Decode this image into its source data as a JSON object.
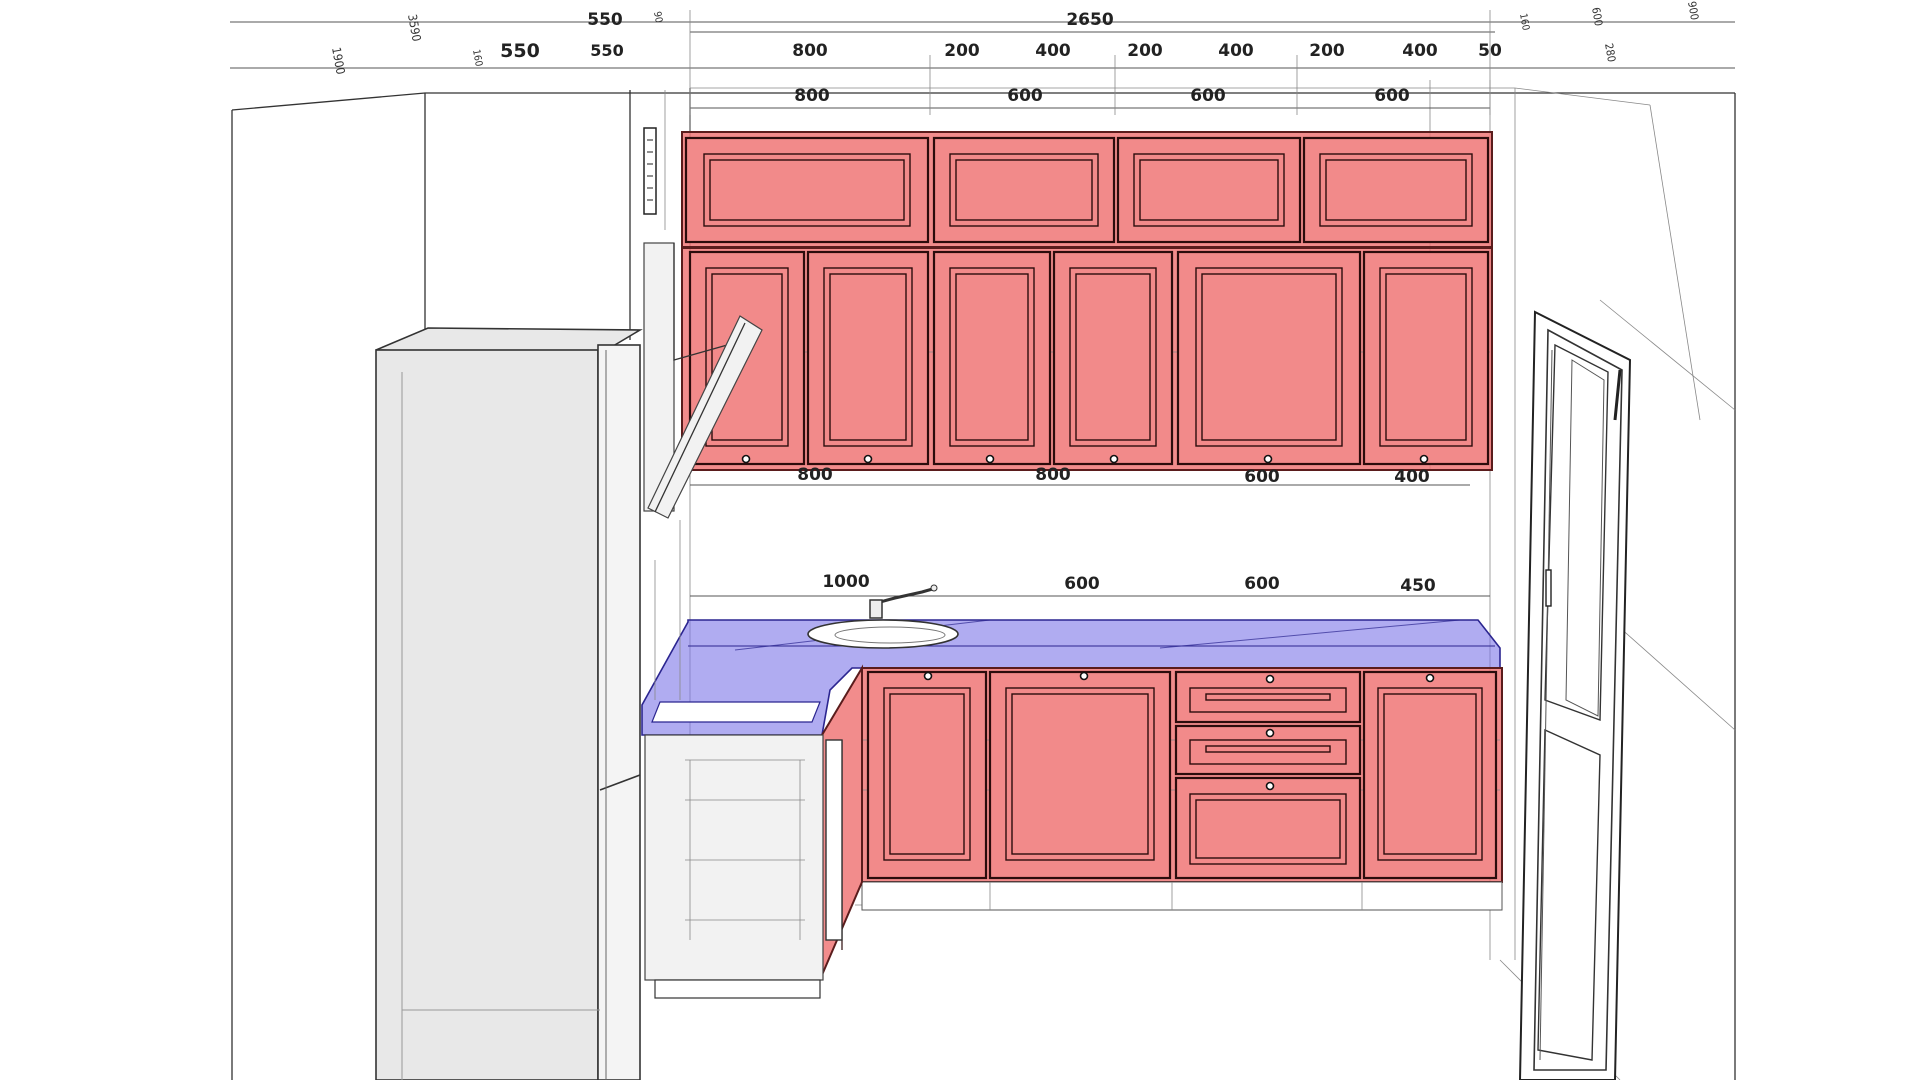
{
  "dimensions": {
    "top_row1": {
      "a": "550",
      "b": "2650"
    },
    "top_row2": {
      "a": "550",
      "b": "550",
      "c": "800",
      "d": "200",
      "e": "400",
      "f": "200",
      "g": "400",
      "h": "200",
      "i": "400",
      "j": "50"
    },
    "upper_cabinets": {
      "a": "800",
      "b": "600",
      "c": "600",
      "d": "600"
    },
    "wall_cabinets": {
      "a": "800",
      "b": "800",
      "c": "600",
      "d": "400"
    },
    "base_cabinets": {
      "a": "1000",
      "b": "600",
      "c": "600",
      "d": "450"
    },
    "small_labels": {
      "s1": "3590",
      "s2": "1900",
      "s3": "160",
      "s4": "90",
      "s5": "160",
      "s6": "600",
      "s7": "900",
      "s8": "280"
    }
  },
  "colors": {
    "cabinet_fill": "#f07878",
    "countertop_fill": "#7b74e8",
    "appliance_fill": "#e8e8e8"
  }
}
